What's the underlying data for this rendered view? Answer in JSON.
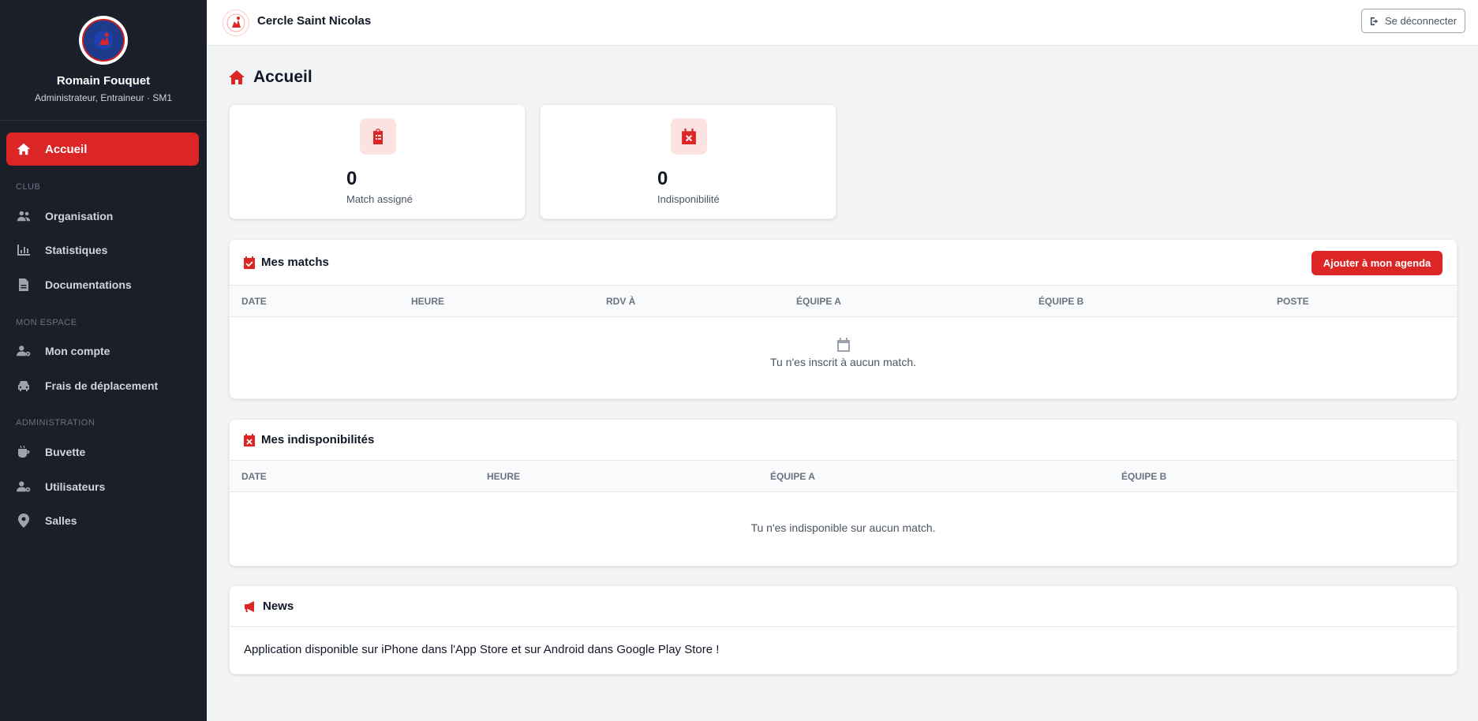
{
  "profile": {
    "name": "Romain Fouquet",
    "role": "Administrateur, Entraineur · SM1"
  },
  "sidebar": {
    "active": {
      "label": "Accueil",
      "icon": "home-icon"
    },
    "sections": [
      {
        "title": "CLUB",
        "items": [
          {
            "label": "Organisation",
            "icon": "users-icon"
          },
          {
            "label": "Statistiques",
            "icon": "chart-icon"
          },
          {
            "label": "Documentations",
            "icon": "file-icon"
          }
        ]
      },
      {
        "title": "MON ESPACE",
        "items": [
          {
            "label": "Mon compte",
            "icon": "user-gear-icon"
          },
          {
            "label": "Frais de déplacement",
            "icon": "car-icon"
          }
        ]
      },
      {
        "title": "ADMINISTRATION",
        "items": [
          {
            "label": "Buvette",
            "icon": "mug-icon"
          },
          {
            "label": "Utilisateurs",
            "icon": "user-gear-icon"
          },
          {
            "label": "Salles",
            "icon": "location-pin-icon"
          }
        ]
      }
    ]
  },
  "topbar": {
    "club_name": "Cercle Saint Nicolas",
    "logout_label": "Se déconnecter"
  },
  "page": {
    "title": "Accueil"
  },
  "stats": [
    {
      "value": "0",
      "label": "Match assigné",
      "icon": "clipboard-list-icon"
    },
    {
      "value": "0",
      "label": "Indisponibilité",
      "icon": "calendar-x-icon"
    }
  ],
  "matches": {
    "title": "Mes matchs",
    "add_button": "Ajouter à mon agenda",
    "columns": [
      "DATE",
      "HEURE",
      "RDV À",
      "ÉQUIPE A",
      "ÉQUIPE B",
      "POSTE"
    ],
    "empty_text": "Tu n'es inscrit à aucun match."
  },
  "unavailability": {
    "title": "Mes indisponibilités",
    "columns": [
      "DATE",
      "HEURE",
      "ÉQUIPE A",
      "ÉQUIPE B"
    ],
    "empty_text": "Tu n'es indisponible sur aucun match."
  },
  "news": {
    "title": "News",
    "text": "Application disponible sur iPhone dans l'App Store et sur Android dans Google Play Store !"
  },
  "colors": {
    "accent": "#dc2626",
    "sidebar_bg": "#1a1f29",
    "page_bg": "#f3f4f6"
  }
}
